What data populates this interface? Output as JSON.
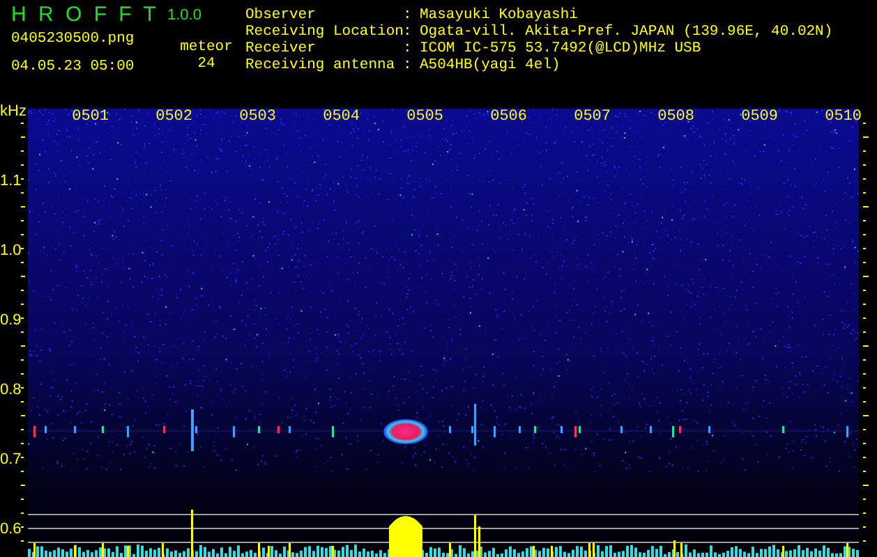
{
  "app": {
    "title": "H R O F F T",
    "version": "1.0.0"
  },
  "file": {
    "name": "0405230500.png",
    "datetime": "04.05.23 05:00"
  },
  "meteor": {
    "label": "meteor",
    "count": "24"
  },
  "info": [
    {
      "label": "Observer",
      "separator": ":",
      "value": "Masayuki Kobayashi"
    },
    {
      "label": "Receiving Location",
      "separator": ":",
      "value": "Ogata-vill. Akita-Pref. JAPAN (139.96E, 40.02N)"
    },
    {
      "label": "Receiver",
      "separator": ":",
      "value": "ICOM IC-575 53.7492(@LCD)MHz USB"
    },
    {
      "label": "Receiving antenna",
      "separator": ":",
      "value": "A504HB(yagi 4el)"
    }
  ],
  "spectrogram": {
    "unit": "kHz",
    "freq_labels": [
      "1.1",
      "1.0",
      "0.9",
      "0.8",
      "0.7",
      "0.6"
    ],
    "time_labels": [
      "0501",
      "0502",
      "0503",
      "0504",
      "0505",
      "0506",
      "0507",
      "0508",
      "0509",
      "0510"
    ]
  }
}
